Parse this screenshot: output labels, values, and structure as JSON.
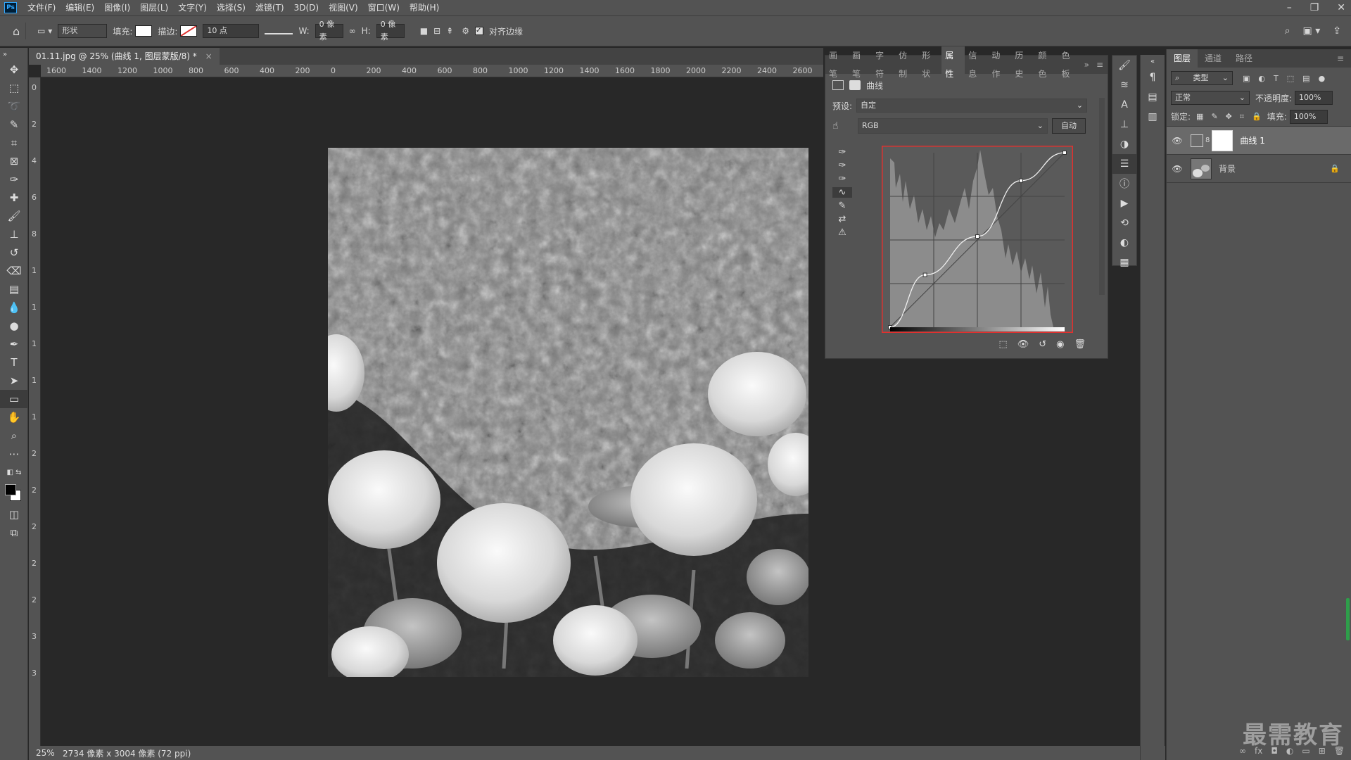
{
  "app": {
    "logo": "Ps"
  },
  "menu": [
    "文件(F)",
    "编辑(E)",
    "图像(I)",
    "图层(L)",
    "文字(Y)",
    "选择(S)",
    "滤镜(T)",
    "3D(D)",
    "视图(V)",
    "窗口(W)",
    "帮助(H)"
  ],
  "options": {
    "mode": "形状",
    "fill_label": "填充:",
    "stroke_label": "描边:",
    "stroke_size": "10 点",
    "w_label": "W:",
    "w_value": "0 像素",
    "h_label": "H:",
    "h_value": "0 像素",
    "align_edges": "对齐边缘"
  },
  "document": {
    "tab_title": "01.11.jpg @ 25% (曲线 1, 图层蒙版/8) *",
    "zoom": "25%",
    "info": "2734 像素 x 3004 像素 (72 ppi)"
  },
  "ruler_h": [
    "1600",
    "1400",
    "1200",
    "1000",
    "800",
    "600",
    "400",
    "200",
    "0",
    "200",
    "400",
    "600",
    "800",
    "1000",
    "1200",
    "1400",
    "1600",
    "1800",
    "2000",
    "2200",
    "2400",
    "2600"
  ],
  "ruler_v": [
    "0",
    "2",
    "4",
    "6",
    "8",
    "1",
    "1",
    "1",
    "1",
    "1",
    "2",
    "2",
    "2",
    "2",
    "2",
    "3",
    "3"
  ],
  "properties": {
    "tabs": [
      "画笔",
      "画笔",
      "字符",
      "仿制",
      "形状",
      "属性",
      "信息",
      "动作",
      "历史",
      "颜色",
      "色板"
    ],
    "active_tab": "属性",
    "title": "曲线",
    "preset_label": "预设:",
    "preset_value": "自定",
    "channel": "RGB",
    "auto_button": "自动",
    "curve_points": [
      [
        0,
        0
      ],
      [
        0.2,
        0.3
      ],
      [
        0.5,
        0.52
      ],
      [
        0.75,
        0.84
      ],
      [
        1,
        1
      ]
    ]
  },
  "layers": {
    "tabs": [
      "图层",
      "通道",
      "路径"
    ],
    "filter": "类型",
    "blend_mode": "正常",
    "opacity_label": "不透明度:",
    "opacity": "100%",
    "lock_label": "锁定:",
    "fill_label": "填充:",
    "fill": "100%",
    "items": [
      {
        "name": "曲线 1"
      },
      {
        "name": "背景"
      }
    ]
  },
  "watermark": "最需教育",
  "colors": {
    "accent_red": "#e0312f",
    "panel": "#535353",
    "dark": "#282828"
  }
}
